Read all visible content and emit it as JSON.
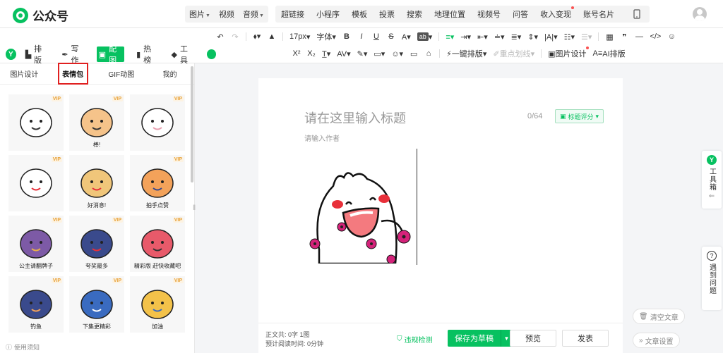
{
  "header": {
    "brand": "公众号",
    "nav_group_1": [
      {
        "label": "图片",
        "caret": true
      },
      {
        "label": "视频",
        "caret": false
      },
      {
        "label": "音频",
        "caret": true
      }
    ],
    "nav_group_2": [
      {
        "label": "超链接",
        "dot": false
      },
      {
        "label": "小程序",
        "dot": false
      },
      {
        "label": "模板",
        "dot": false
      },
      {
        "label": "投票",
        "dot": false
      },
      {
        "label": "搜索",
        "dot": false
      },
      {
        "label": "地理位置",
        "dot": false
      },
      {
        "label": "视频号",
        "dot": false
      },
      {
        "label": "问答",
        "dot": false
      },
      {
        "label": "收入变现",
        "dot": true
      },
      {
        "label": "账号名片",
        "dot": false
      }
    ],
    "more": "···"
  },
  "toolbar": {
    "font_size": "17px",
    "font_family": "字体",
    "row1": [
      "↶",
      "↷",
      "⬧",
      "▲",
      "B",
      "I",
      "U",
      "S",
      "A",
      "ab",
      "☰",
      "☷",
      "≣",
      "≡",
      "≡",
      "↕",
      "|A|",
      "☷",
      "☰",
      "▦",
      "❞",
      "—",
      "</>",
      "☺"
    ],
    "row2_quick_layout": "一键排版",
    "row2_underline": "重点划线",
    "row2_image_design": "图片设计",
    "row2_ai": "AI排版",
    "accent": "#07c160"
  },
  "left_tabs": {
    "items": [
      {
        "label": "排版",
        "active": false
      },
      {
        "label": "写作",
        "active": false
      },
      {
        "label": "配图",
        "active": true
      },
      {
        "label": "热榜",
        "active": false
      },
      {
        "label": "工具",
        "active": false
      }
    ]
  },
  "sidebar": {
    "subtabs": [
      {
        "label": "图片设计",
        "active": false
      },
      {
        "label": "表情包",
        "active": true
      },
      {
        "label": "GIF动图",
        "active": false
      },
      {
        "label": "我的",
        "active": false
      }
    ],
    "stickers": [
      {
        "vip": "VIP",
        "caption": ""
      },
      {
        "vip": "VIP",
        "caption": "棒!"
      },
      {
        "vip": "VIP",
        "caption": ""
      },
      {
        "vip": "VIP",
        "caption": ""
      },
      {
        "vip": "",
        "caption": "好消息!"
      },
      {
        "vip": "VIP",
        "caption": "拍手点赞"
      },
      {
        "vip": "VIP",
        "caption": "公主请翻牌子"
      },
      {
        "vip": "VIP",
        "caption": "夸奖最多"
      },
      {
        "vip": "VIP",
        "caption": "精彩版 赶快收藏吧"
      },
      {
        "vip": "VIP",
        "caption": "钓鱼"
      },
      {
        "vip": "VIP",
        "caption": "下集更精彩"
      },
      {
        "vip": "VIP",
        "caption": "加油"
      }
    ],
    "footer": "使用须知"
  },
  "editor": {
    "title_placeholder": "请在这里输入标题",
    "title_count": "0/64",
    "score_button": "标题评分",
    "author_placeholder": "请输入作者"
  },
  "bottom": {
    "word_count_label": "正文共:",
    "word_count_value": "0字 1图",
    "read_time_label": "预计阅读时间:",
    "read_time_value": "0分钟",
    "check": "违规检测",
    "save": "保存为草稿",
    "preview": "预览",
    "publish": "发表"
  },
  "right": {
    "toolbox": "工具箱",
    "help": "遇到问题",
    "clear": "清空文章",
    "settings": "文章设置"
  }
}
